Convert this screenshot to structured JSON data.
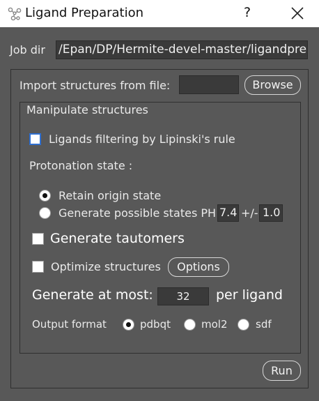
{
  "window": {
    "title": "Ligand Preparation",
    "help_label": "?"
  },
  "job_dir": {
    "label": "Job dir",
    "value": "/Epan/DP/Hermite-devel-master/ligandpre"
  },
  "import": {
    "label": "Import structures from file:",
    "value": "",
    "browse_label": "Browse"
  },
  "manipulate": {
    "group_label": "Manipulate structures",
    "lipinski_label": "Ligands filtering by Lipinski's rule",
    "lipinski_checked": false,
    "protonation_label": "Protonation state :",
    "retain_label": "Retain origin state",
    "retain_selected": true,
    "generate_label": "Generate possible states PH",
    "ph_value": "7.4",
    "pm_label": "+/-",
    "ph_range": "1.0",
    "tautomers_label": "Generate tautomers",
    "tautomers_checked": false,
    "optimize_label": "Optimize structures",
    "optimize_checked": false,
    "options_label": "Options",
    "at_most_label": "Generate at most:",
    "at_most_value": "32",
    "per_ligand_label": "per ligand",
    "output_label": "Output format",
    "formats": [
      "pdbqt",
      "mol2",
      "sdf"
    ],
    "selected_format": "pdbqt"
  },
  "run_label": "Run"
}
